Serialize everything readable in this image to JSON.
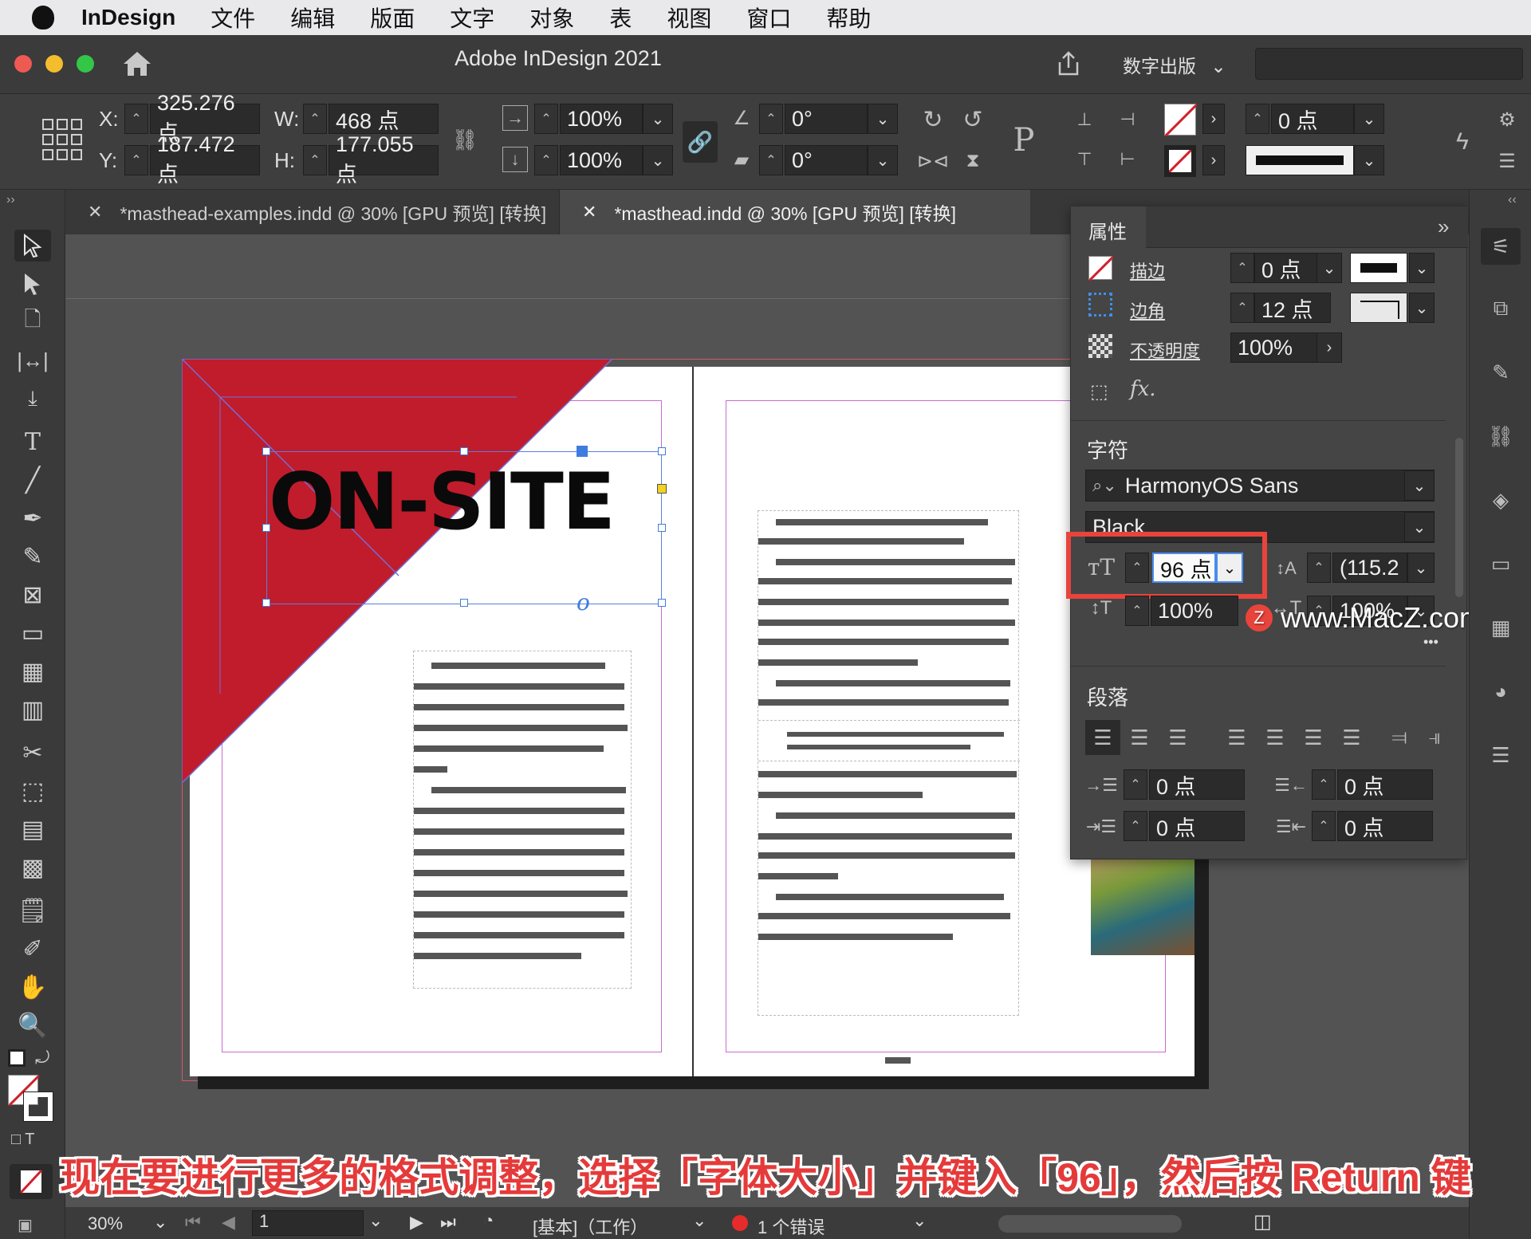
{
  "menubar": {
    "app_name": "InDesign",
    "items": [
      "文件",
      "编辑",
      "版面",
      "文字",
      "对象",
      "表",
      "视图",
      "窗口",
      "帮助"
    ]
  },
  "titlebar": {
    "title": "Adobe InDesign 2021",
    "workspace": "数字出版"
  },
  "controlbar": {
    "x_label": "X:",
    "x_value": "325.276 点",
    "y_label": "Y:",
    "y_value": "187.472 点",
    "w_label": "W:",
    "w_value": "468 点",
    "h_label": "H:",
    "h_value": "177.055 点",
    "scale_x": "100%",
    "scale_y": "100%",
    "rotate": "0°",
    "shear": "0°",
    "stroke_weight": "0 点"
  },
  "tabs": [
    {
      "label": "*masthead-examples.indd @ 30% [GPU 预览] [转换]",
      "active": false
    },
    {
      "label": "*masthead.indd @ 30% [GPU 预览] [转换]",
      "active": true
    }
  ],
  "document": {
    "headline": "ON-SITE",
    "link_symbol": "o"
  },
  "properties": {
    "panel_title": "属性",
    "stroke_label": "描边",
    "stroke_value": "0 点",
    "corner_label": "边角",
    "corner_value": "12 点",
    "opacity_label": "不透明度",
    "opacity_value": "100%",
    "fx_label": "fx.",
    "character_heading": "字符",
    "font_family": "HarmonyOS Sans",
    "font_style": "Black",
    "font_size": "96 点",
    "leading": "(115.2",
    "vertical_scale": "100%",
    "horizontal_scale": "100%",
    "more": "•••",
    "paragraph_heading": "段落",
    "left_indent": "0 点",
    "right_indent": "0 点",
    "first_line_indent": "0 点",
    "last_line_indent": "0 点"
  },
  "watermark": "www.MacZ.com",
  "statusbar": {
    "zoom": "30%",
    "page": "1",
    "style": "[基本]（工作）",
    "errors": "1 个错误"
  },
  "caption": "现在要进行更多的格式调整，选择「字体大小」并键入「96」，然后按 Return 键",
  "colors": {
    "accent_red": "#c01c2c",
    "highlight_box": "#e8443c",
    "selection_blue": "#3f7ce0"
  }
}
